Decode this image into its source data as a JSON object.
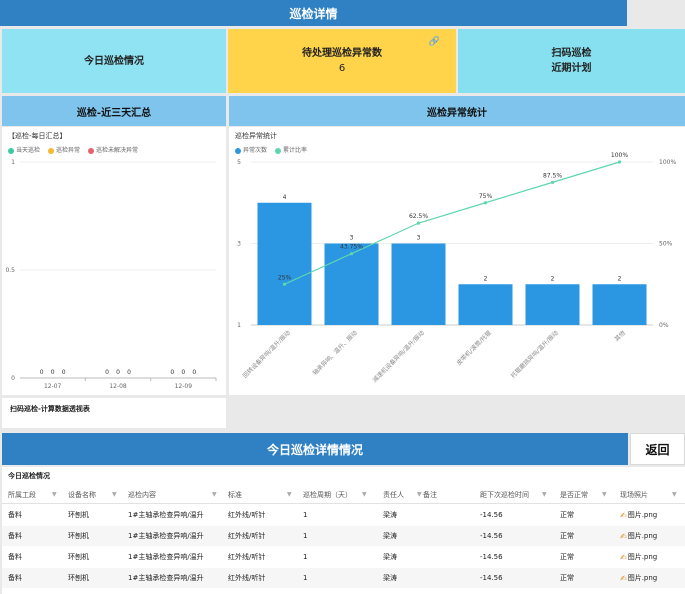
{
  "header": {
    "title": "巡检详情"
  },
  "cards": {
    "today": {
      "label": "今日巡检情况"
    },
    "pending": {
      "label": "待处理巡检异常数",
      "count": "6"
    },
    "scan": {
      "line1": "扫码巡检",
      "line2": "近期计划"
    }
  },
  "sections": {
    "left_title": "巡检-近三天汇总",
    "right_title": "巡检异常统计"
  },
  "chart_data": [
    {
      "type": "bar",
      "title": "【巡检-每日汇总】",
      "legend": [
        "当天巡检",
        "巡检异常",
        "巡检未解决异常"
      ],
      "colors": [
        "#3ec9a6",
        "#f5b82e",
        "#e8616d"
      ],
      "categories": [
        "12-07",
        "12-08",
        "12-09"
      ],
      "series": [
        {
          "name": "当天巡检",
          "values": [
            0,
            0,
            0
          ]
        },
        {
          "name": "巡检异常",
          "values": [
            0,
            0,
            0
          ]
        },
        {
          "name": "巡检未解决异常",
          "values": [
            0,
            0,
            0
          ]
        }
      ],
      "ylim": [
        0,
        1
      ],
      "yticks": [
        "0",
        "0.5",
        "1"
      ]
    },
    {
      "type": "bar",
      "title": "巡检异常统计",
      "legend": [
        "异常次数",
        "累计比率"
      ],
      "colors": [
        "#2b97e3",
        "#5fd6ae"
      ],
      "categories": [
        "回转设备异响/温升/振动",
        "轴承异响、温升、振动",
        "减速机设备异响/温升/振动",
        "皮带机/滚筒/托辊",
        "托辊磨损异响/温升/振动",
        "其他"
      ],
      "series": [
        {
          "name": "异常次数",
          "values": [
            4,
            3,
            3,
            2,
            2,
            2
          ]
        },
        {
          "name": "累计比率",
          "values": [
            25,
            43.75,
            62.5,
            75,
            87.5,
            100
          ]
        }
      ],
      "value_labels": [
        "4",
        "3",
        "3",
        "2",
        "2",
        "2"
      ],
      "ratio_labels": [
        "25%",
        "43.75%",
        "62.5%",
        "75%",
        "87.5%",
        "100%"
      ],
      "ylim": [
        1,
        5
      ],
      "yticks": [
        "1",
        "3",
        "5"
      ],
      "y2lim": [
        0,
        100
      ],
      "y2ticks": [
        "0%",
        "50%",
        "100%"
      ]
    }
  ],
  "scan_report": {
    "title": "扫码巡检-计算数据透视表"
  },
  "detail": {
    "title": "今日巡检详情情况",
    "back_label": "返回"
  },
  "table": {
    "title": "今日巡检情况",
    "headers": [
      "所属工段",
      "设备名称",
      "巡检内容",
      "标准",
      "巡检周期（天）",
      "责任人",
      "备注",
      "距下次巡检时间",
      "是否正常",
      "现场照片"
    ],
    "rows": [
      [
        "备料",
        "环刨机",
        "1#主轴承检查异响/温升",
        "红外线/听针",
        "1",
        "梁涛",
        "",
        "-14.56",
        "正常",
        "图片.png"
      ],
      [
        "备料",
        "环刨机",
        "1#主轴承检查异响/温升",
        "红外线/听针",
        "1",
        "梁涛",
        "",
        "-14.56",
        "正常",
        "图片.png"
      ],
      [
        "备料",
        "环刨机",
        "1#主轴承检查异响/温升",
        "红外线/听针",
        "1",
        "梁涛",
        "",
        "-14.56",
        "正常",
        "图片.png"
      ],
      [
        "备料",
        "环刨机",
        "1#主轴承检查异响/温升",
        "红外线/听针",
        "1",
        "梁涛",
        "",
        "-14.56",
        "正常",
        "图片.png"
      ]
    ]
  }
}
